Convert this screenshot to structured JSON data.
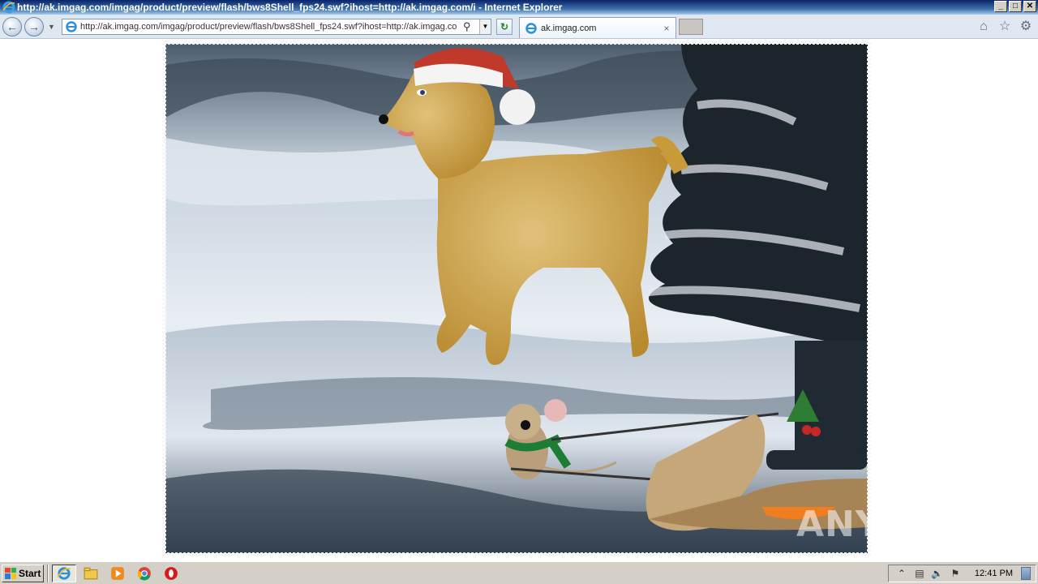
{
  "window": {
    "title": "http://ak.imgag.com/imgag/product/preview/flash/bws8Shell_fps24.swf?ihost=http://ak.imgag.com/i - Internet Explorer",
    "buttons": {
      "minimize": "_",
      "maximize": "□",
      "close": "✕"
    }
  },
  "navbar": {
    "back_icon": "back-arrow-icon",
    "forward_icon": "forward-arrow-icon",
    "address": "http://ak.imgag.com/imgag/product/preview/flash/bws8Shell_fps24.swf?ihost=http://ak.imgag.co",
    "tab_label": "ak.imgag.com",
    "tab_close": "×"
  },
  "content": {
    "watermark": "ANY▷RUN"
  },
  "taskbar": {
    "start_label": "Start",
    "apps": [
      "internet-explorer-icon",
      "file-explorer-icon",
      "media-player-icon",
      "chrome-icon",
      "opera-icon"
    ],
    "clock": "12:41 PM"
  },
  "colors": {
    "titlebar": "#0a246a",
    "taskbar": "#d4d0c8",
    "dog_fur": "#c99a3a",
    "santa_hat": "#c0392b"
  }
}
